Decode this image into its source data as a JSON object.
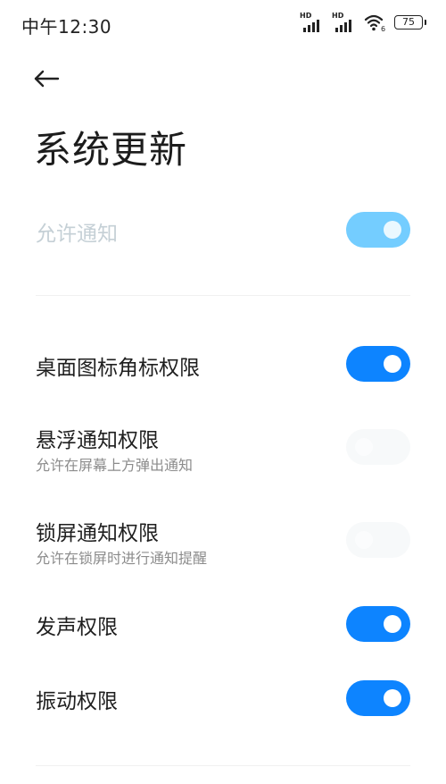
{
  "status_bar": {
    "time": "中午12:30",
    "signal_1_badge": "HD",
    "signal_2_badge": "HD",
    "wifi_badge": "6",
    "battery_level": "75"
  },
  "header": {
    "back_icon": "arrow-left-icon",
    "title": "系统更新"
  },
  "master": {
    "label": "允许通知",
    "enabled": false,
    "on": true,
    "label_color": "#c5d0d6",
    "toggle_color": "#74cdff"
  },
  "settings": [
    {
      "title": "桌面图标角标权限",
      "subtitle": "",
      "on": true,
      "enabled": true
    },
    {
      "title": "悬浮通知权限",
      "subtitle": "允许在屏幕上方弹出通知",
      "on": false,
      "enabled": false
    },
    {
      "title": "锁屏通知权限",
      "subtitle": "允许在锁屏时进行通知提醒",
      "on": false,
      "enabled": false
    },
    {
      "title": "发声权限",
      "subtitle": "",
      "on": true,
      "enabled": true
    },
    {
      "title": "振动权限",
      "subtitle": "",
      "on": true,
      "enabled": true
    }
  ],
  "colors": {
    "accent": "#0d84ff",
    "text_primary": "#1f1f1f",
    "text_secondary": "#8c8c8c",
    "divider": "#f0f0f0"
  }
}
